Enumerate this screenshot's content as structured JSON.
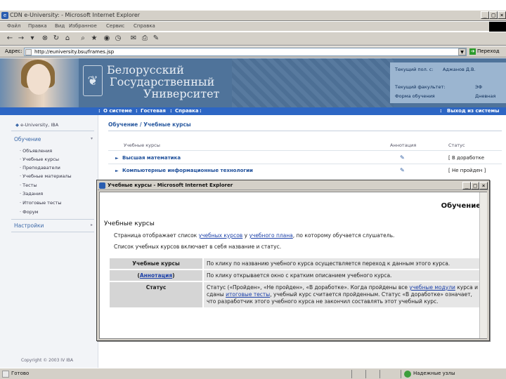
{
  "window": {
    "title": "CDN e-University: - Microsoft Internet Explorer",
    "minimize": "_",
    "maximize": "□",
    "close": "×"
  },
  "menu": [
    "Файл",
    "Правка",
    "Вид",
    "Избранное",
    "Сервис",
    "Справка"
  ],
  "address": {
    "label": "Адрес:",
    "url": "http://euniversity.bsu/frames.jsp",
    "go_label": "Переход"
  },
  "header": {
    "university_lines": [
      "Белорусский",
      "Государственный",
      "Университет"
    ],
    "user_label": "Текущий пол. с:",
    "user_name": "Аджанов Д.В.",
    "faculty_label": "Текущий факультет:",
    "faculty_value": "ЭФ",
    "study_form_label": "Форма обучения",
    "study_form_value": "Дневная"
  },
  "nav": {
    "items": [
      "О системе",
      "Гостевая",
      "Справка"
    ],
    "logout": "Выход из системы"
  },
  "sidebar": {
    "logo_text": "e-University, IBA",
    "section_learning": "Обучение",
    "items": [
      "Объявления",
      "Учебные курсы",
      "Преподаватели",
      "Учебные материалы",
      "Тесты",
      "Задания",
      "Итоговые тесты",
      "Форум"
    ],
    "section_settings": "Настройки",
    "copyright": "Copyright © 2003 IV IBA"
  },
  "content": {
    "breadcrumb": "Обучение / Учебные курсы",
    "col_course": "Учебные курсы",
    "col_annotation": "Аннотация",
    "col_status": "Статус",
    "rows": [
      {
        "name": "Высшая математика",
        "status": "[ В доработке"
      },
      {
        "name": "Компьютерные информационные технологии",
        "status": "[ Не пройден ]"
      }
    ]
  },
  "popup": {
    "title": "Учебные курсы - Microsoft Internet Explorer",
    "heading_right": "Обучение",
    "heading": "Учебные курсы",
    "line1_pre": "Страница отображает список ",
    "line1_link1": "учебных курсов",
    "line1_mid": " у ",
    "line1_link2": "учебного плана",
    "line1_post": ", по которому обучается слушатель.",
    "line2": "Список учебных курсов включает в себя название и статус.",
    "table": [
      {
        "label": "Учебные курсы",
        "text": "По клику по названию учебного курса осуществляется переход к данным этого курса."
      },
      {
        "label_pre": "(",
        "label_link": "Аннотация",
        "label_post": ")",
        "text": "По клику открывается окно с кратким описанием учебного курса."
      },
      {
        "label": "Статус",
        "text_pre": "Статус («Пройден», «Не пройден», «В доработке». Когда пройдены все ",
        "link1": "учебные модули",
        "text_mid": " курса и сданы ",
        "link2": "итоговые тесты",
        "text_post": ", учебный курс считается пройденным. Статус «В доработке» означает, что разработчик этого учебного курса не закончил составлять этот учебный курс."
      }
    ]
  },
  "statusbar": {
    "status": "Готово",
    "zone": "Надежные узлы"
  }
}
